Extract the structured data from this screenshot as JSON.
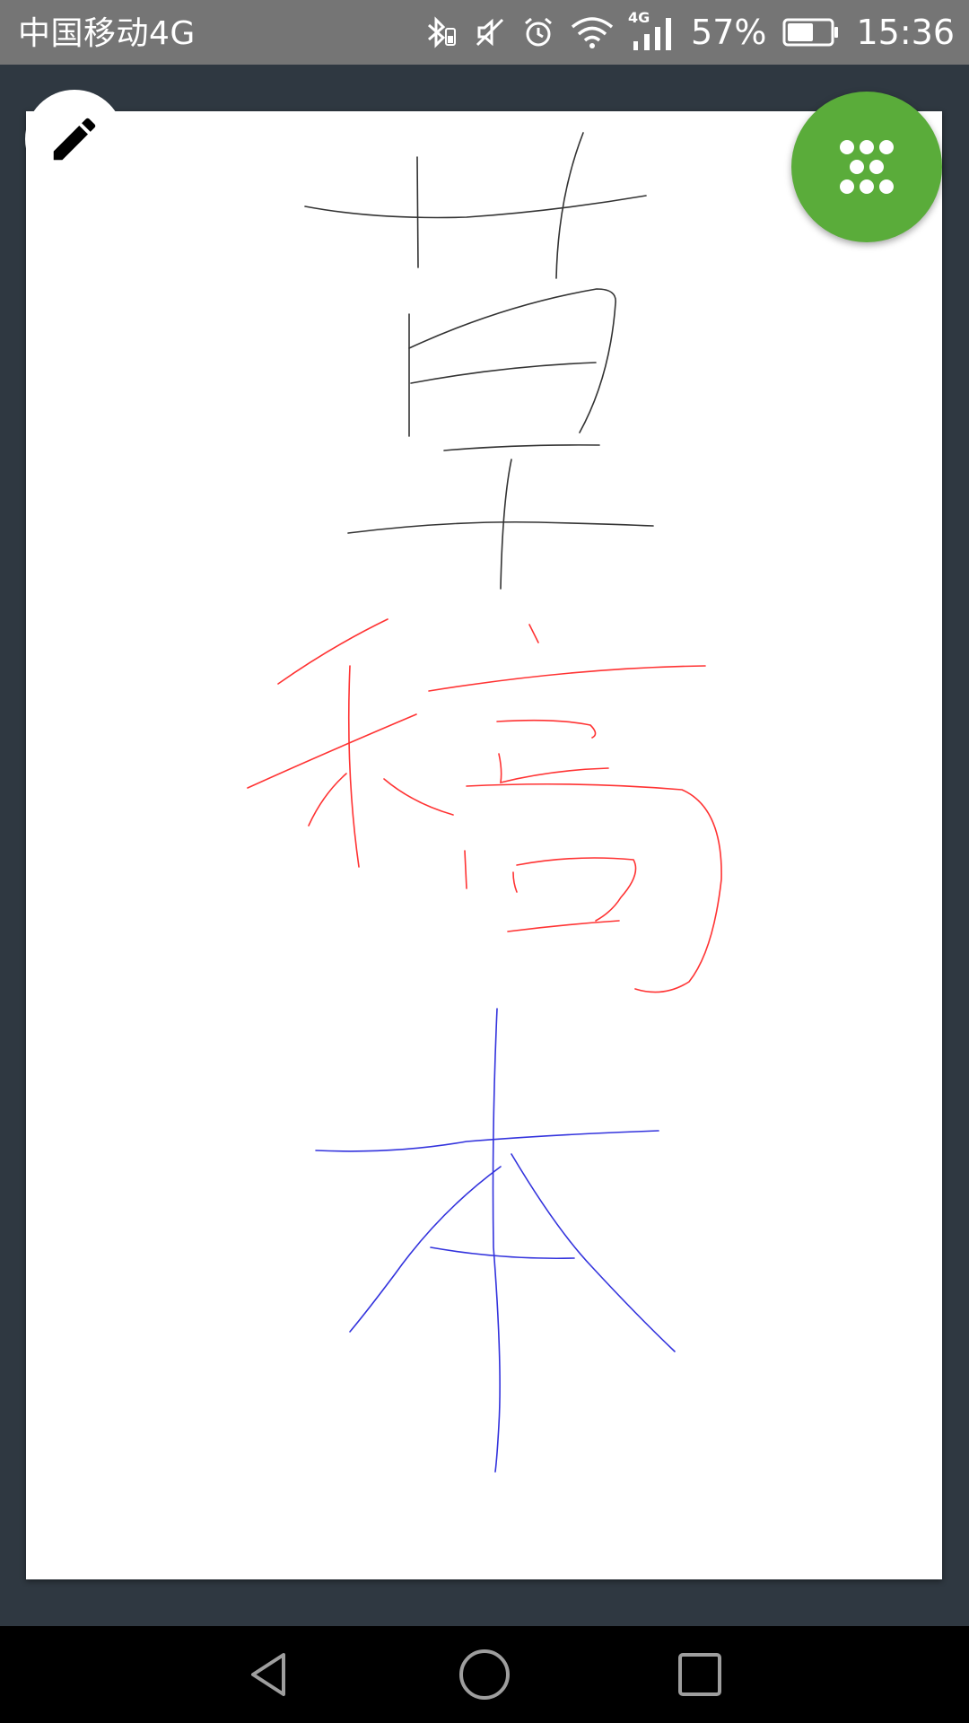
{
  "status_bar": {
    "carrier": "中国移动4G",
    "network_badge": "4G",
    "battery_percent": "57%",
    "time": "15:36",
    "icons": [
      "bluetooth-icon",
      "battery-small-icon",
      "mute-icon",
      "alarm-icon",
      "wifi-icon",
      "signal-icon",
      "battery-icon"
    ]
  },
  "canvas": {
    "characters": [
      "草",
      "稿",
      "本"
    ],
    "stroke_colors": [
      "#333333",
      "#ff3333",
      "#3333dd"
    ]
  },
  "toolbar": {
    "pen_icon": "pencil-icon",
    "menu_icon": "dots-grid-icon",
    "menu_color": "#5aac3a"
  },
  "nav_bar": {
    "icons": [
      "back-icon",
      "home-icon",
      "recents-icon"
    ]
  }
}
